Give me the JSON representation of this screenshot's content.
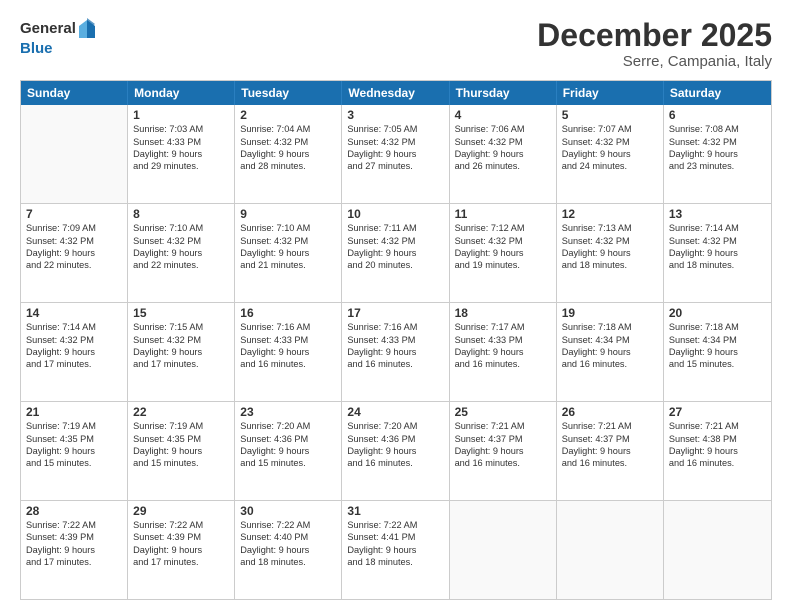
{
  "logo": {
    "general": "General",
    "blue": "Blue"
  },
  "title": "December 2025",
  "location": "Serre, Campania, Italy",
  "header_days": [
    "Sunday",
    "Monday",
    "Tuesday",
    "Wednesday",
    "Thursday",
    "Friday",
    "Saturday"
  ],
  "rows": [
    [
      {
        "num": "",
        "lines": []
      },
      {
        "num": "1",
        "lines": [
          "Sunrise: 7:03 AM",
          "Sunset: 4:33 PM",
          "Daylight: 9 hours",
          "and 29 minutes."
        ]
      },
      {
        "num": "2",
        "lines": [
          "Sunrise: 7:04 AM",
          "Sunset: 4:32 PM",
          "Daylight: 9 hours",
          "and 28 minutes."
        ]
      },
      {
        "num": "3",
        "lines": [
          "Sunrise: 7:05 AM",
          "Sunset: 4:32 PM",
          "Daylight: 9 hours",
          "and 27 minutes."
        ]
      },
      {
        "num": "4",
        "lines": [
          "Sunrise: 7:06 AM",
          "Sunset: 4:32 PM",
          "Daylight: 9 hours",
          "and 26 minutes."
        ]
      },
      {
        "num": "5",
        "lines": [
          "Sunrise: 7:07 AM",
          "Sunset: 4:32 PM",
          "Daylight: 9 hours",
          "and 24 minutes."
        ]
      },
      {
        "num": "6",
        "lines": [
          "Sunrise: 7:08 AM",
          "Sunset: 4:32 PM",
          "Daylight: 9 hours",
          "and 23 minutes."
        ]
      }
    ],
    [
      {
        "num": "7",
        "lines": [
          "Sunrise: 7:09 AM",
          "Sunset: 4:32 PM",
          "Daylight: 9 hours",
          "and 22 minutes."
        ]
      },
      {
        "num": "8",
        "lines": [
          "Sunrise: 7:10 AM",
          "Sunset: 4:32 PM",
          "Daylight: 9 hours",
          "and 22 minutes."
        ]
      },
      {
        "num": "9",
        "lines": [
          "Sunrise: 7:10 AM",
          "Sunset: 4:32 PM",
          "Daylight: 9 hours",
          "and 21 minutes."
        ]
      },
      {
        "num": "10",
        "lines": [
          "Sunrise: 7:11 AM",
          "Sunset: 4:32 PM",
          "Daylight: 9 hours",
          "and 20 minutes."
        ]
      },
      {
        "num": "11",
        "lines": [
          "Sunrise: 7:12 AM",
          "Sunset: 4:32 PM",
          "Daylight: 9 hours",
          "and 19 minutes."
        ]
      },
      {
        "num": "12",
        "lines": [
          "Sunrise: 7:13 AM",
          "Sunset: 4:32 PM",
          "Daylight: 9 hours",
          "and 18 minutes."
        ]
      },
      {
        "num": "13",
        "lines": [
          "Sunrise: 7:14 AM",
          "Sunset: 4:32 PM",
          "Daylight: 9 hours",
          "and 18 minutes."
        ]
      }
    ],
    [
      {
        "num": "14",
        "lines": [
          "Sunrise: 7:14 AM",
          "Sunset: 4:32 PM",
          "Daylight: 9 hours",
          "and 17 minutes."
        ]
      },
      {
        "num": "15",
        "lines": [
          "Sunrise: 7:15 AM",
          "Sunset: 4:32 PM",
          "Daylight: 9 hours",
          "and 17 minutes."
        ]
      },
      {
        "num": "16",
        "lines": [
          "Sunrise: 7:16 AM",
          "Sunset: 4:33 PM",
          "Daylight: 9 hours",
          "and 16 minutes."
        ]
      },
      {
        "num": "17",
        "lines": [
          "Sunrise: 7:16 AM",
          "Sunset: 4:33 PM",
          "Daylight: 9 hours",
          "and 16 minutes."
        ]
      },
      {
        "num": "18",
        "lines": [
          "Sunrise: 7:17 AM",
          "Sunset: 4:33 PM",
          "Daylight: 9 hours",
          "and 16 minutes."
        ]
      },
      {
        "num": "19",
        "lines": [
          "Sunrise: 7:18 AM",
          "Sunset: 4:34 PM",
          "Daylight: 9 hours",
          "and 16 minutes."
        ]
      },
      {
        "num": "20",
        "lines": [
          "Sunrise: 7:18 AM",
          "Sunset: 4:34 PM",
          "Daylight: 9 hours",
          "and 15 minutes."
        ]
      }
    ],
    [
      {
        "num": "21",
        "lines": [
          "Sunrise: 7:19 AM",
          "Sunset: 4:35 PM",
          "Daylight: 9 hours",
          "and 15 minutes."
        ]
      },
      {
        "num": "22",
        "lines": [
          "Sunrise: 7:19 AM",
          "Sunset: 4:35 PM",
          "Daylight: 9 hours",
          "and 15 minutes."
        ]
      },
      {
        "num": "23",
        "lines": [
          "Sunrise: 7:20 AM",
          "Sunset: 4:36 PM",
          "Daylight: 9 hours",
          "and 15 minutes."
        ]
      },
      {
        "num": "24",
        "lines": [
          "Sunrise: 7:20 AM",
          "Sunset: 4:36 PM",
          "Daylight: 9 hours",
          "and 16 minutes."
        ]
      },
      {
        "num": "25",
        "lines": [
          "Sunrise: 7:21 AM",
          "Sunset: 4:37 PM",
          "Daylight: 9 hours",
          "and 16 minutes."
        ]
      },
      {
        "num": "26",
        "lines": [
          "Sunrise: 7:21 AM",
          "Sunset: 4:37 PM",
          "Daylight: 9 hours",
          "and 16 minutes."
        ]
      },
      {
        "num": "27",
        "lines": [
          "Sunrise: 7:21 AM",
          "Sunset: 4:38 PM",
          "Daylight: 9 hours",
          "and 16 minutes."
        ]
      }
    ],
    [
      {
        "num": "28",
        "lines": [
          "Sunrise: 7:22 AM",
          "Sunset: 4:39 PM",
          "Daylight: 9 hours",
          "and 17 minutes."
        ]
      },
      {
        "num": "29",
        "lines": [
          "Sunrise: 7:22 AM",
          "Sunset: 4:39 PM",
          "Daylight: 9 hours",
          "and 17 minutes."
        ]
      },
      {
        "num": "30",
        "lines": [
          "Sunrise: 7:22 AM",
          "Sunset: 4:40 PM",
          "Daylight: 9 hours",
          "and 18 minutes."
        ]
      },
      {
        "num": "31",
        "lines": [
          "Sunrise: 7:22 AM",
          "Sunset: 4:41 PM",
          "Daylight: 9 hours",
          "and 18 minutes."
        ]
      },
      {
        "num": "",
        "lines": []
      },
      {
        "num": "",
        "lines": []
      },
      {
        "num": "",
        "lines": []
      }
    ]
  ]
}
